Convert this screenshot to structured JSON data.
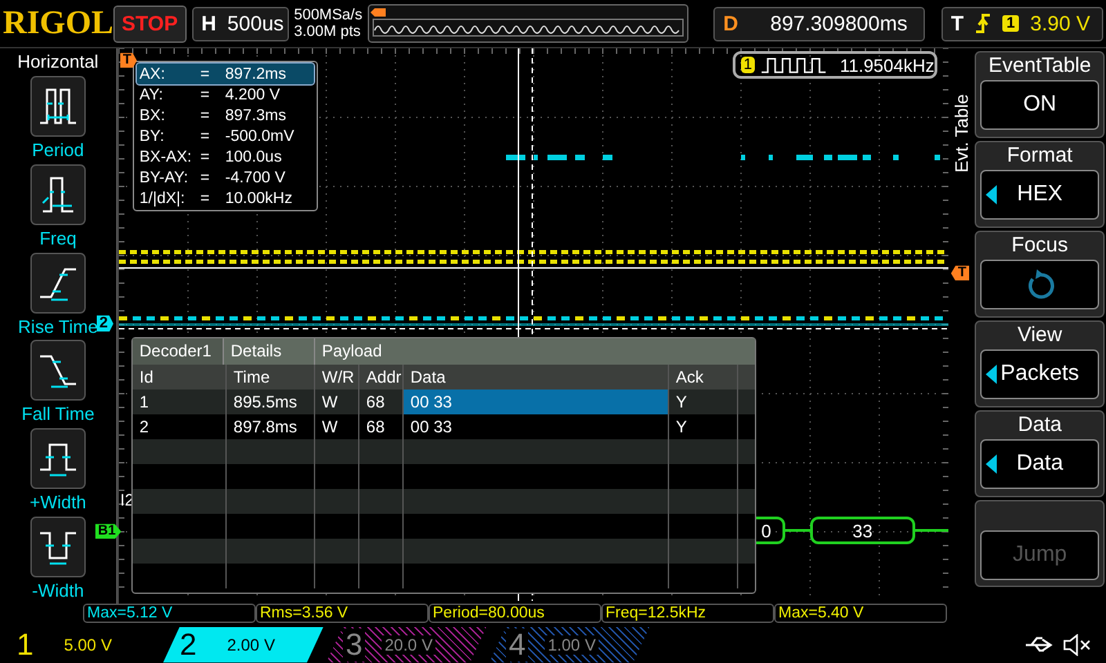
{
  "top_bar": {
    "logo": "RIGOL",
    "run_state": "STOP",
    "timebase": {
      "label": "H",
      "value": "500us"
    },
    "sample_rate": "500MSa/s",
    "memory_depth": "3.00M pts",
    "delay": {
      "label": "D",
      "value": "897.309800ms"
    },
    "trigger": {
      "label": "T",
      "source": "1",
      "level": "3.90 V"
    }
  },
  "left_menu": {
    "title": "Horizontal",
    "items": [
      {
        "kind": "period",
        "label": "Period"
      },
      {
        "kind": "freq",
        "label": "Freq"
      },
      {
        "kind": "rise",
        "label": "Rise Time"
      },
      {
        "kind": "fall",
        "label": "Fall Time"
      },
      {
        "kind": "pwidth",
        "label": "+Width"
      },
      {
        "kind": "nwidth",
        "label": "-Width"
      }
    ]
  },
  "graticule": {
    "trigger_position_marker": "T",
    "trigger_level_marker": "T",
    "channel_marker": "2",
    "bus_marker": "B1",
    "bus_label": "I2",
    "bus_packets": [
      "0",
      "33"
    ]
  },
  "cursor_readout": [
    {
      "label": "AX:",
      "separator": "=",
      "value": "897.2ms",
      "selected": true
    },
    {
      "label": "AY:",
      "separator": "=",
      "value": "4.200 V",
      "selected": false
    },
    {
      "label": "BX:",
      "separator": "=",
      "value": "897.3ms",
      "selected": false
    },
    {
      "label": "BY:",
      "separator": "=",
      "value": "-500.0mV",
      "selected": false
    },
    {
      "label": "BX-AX:",
      "separator": "=",
      "value": "100.0us",
      "selected": false
    },
    {
      "label": "BY-AY:",
      "separator": "=",
      "value": "-4.700 V",
      "selected": false
    },
    {
      "label": "1/|dX|:",
      "separator": "=",
      "value": "10.00kHz",
      "selected": false
    }
  ],
  "frequency_counter": {
    "channel": "1",
    "value": "11.9504kHz"
  },
  "event_table": {
    "header": [
      "Decoder1",
      "Details",
      "Payload"
    ],
    "columns": [
      {
        "label": "Id",
        "focused": false
      },
      {
        "label": "Time",
        "focused": false
      },
      {
        "label": "W/R",
        "focused": false
      },
      {
        "label": "Addr",
        "focused": false
      },
      {
        "label": "Data",
        "focused": true
      },
      {
        "label": "Ack",
        "focused": false
      }
    ],
    "rows": [
      {
        "cells": [
          "1",
          "895.5ms",
          "W",
          "68",
          "00 33",
          "Y"
        ],
        "selected": true
      },
      {
        "cells": [
          "2",
          "897.8ms",
          "W",
          "68",
          "00 33",
          "Y"
        ],
        "selected": false
      }
    ]
  },
  "right_menu": {
    "side_tab": "Evt. Table",
    "items": [
      {
        "kind": "value",
        "title": "EventTable",
        "value": "ON",
        "arrow": false,
        "disabled": false
      },
      {
        "kind": "value",
        "title": "Format",
        "value": "HEX",
        "arrow": true,
        "disabled": false
      },
      {
        "kind": "knob",
        "title": "Focus"
      },
      {
        "kind": "value",
        "title": "View",
        "value": "Packets",
        "arrow": true,
        "disabled": false
      },
      {
        "kind": "value",
        "title": "Data",
        "value": "Data",
        "arrow": true,
        "disabled": false
      },
      {
        "kind": "value",
        "value": "Jump",
        "arrow": false,
        "disabled": true
      }
    ]
  },
  "measurements": [
    {
      "text": "Max=5.12 V",
      "color": "#00e8f0"
    },
    {
      "text": "Rms=3.56 V",
      "color": "#f0f000"
    },
    {
      "text": "Period=80.00us",
      "color": "#f0f000"
    },
    {
      "text": "Freq=12.5kHz",
      "color": "#f0f000"
    },
    {
      "text": "Max=5.40 V",
      "color": "#f0f000"
    }
  ],
  "channels": [
    {
      "number": "1",
      "scale": "5.00 V",
      "on": true,
      "selected": false,
      "color": "#f0e000"
    },
    {
      "number": "2",
      "scale": "2.00 V",
      "on": true,
      "selected": true,
      "color": "#00e8f0"
    },
    {
      "number": "3",
      "scale": "20.0 V",
      "on": false,
      "selected": false,
      "color": "#a0208c"
    },
    {
      "number": "4",
      "scale": "1.00 V",
      "on": false,
      "selected": false,
      "color": "#2050a0"
    }
  ]
}
